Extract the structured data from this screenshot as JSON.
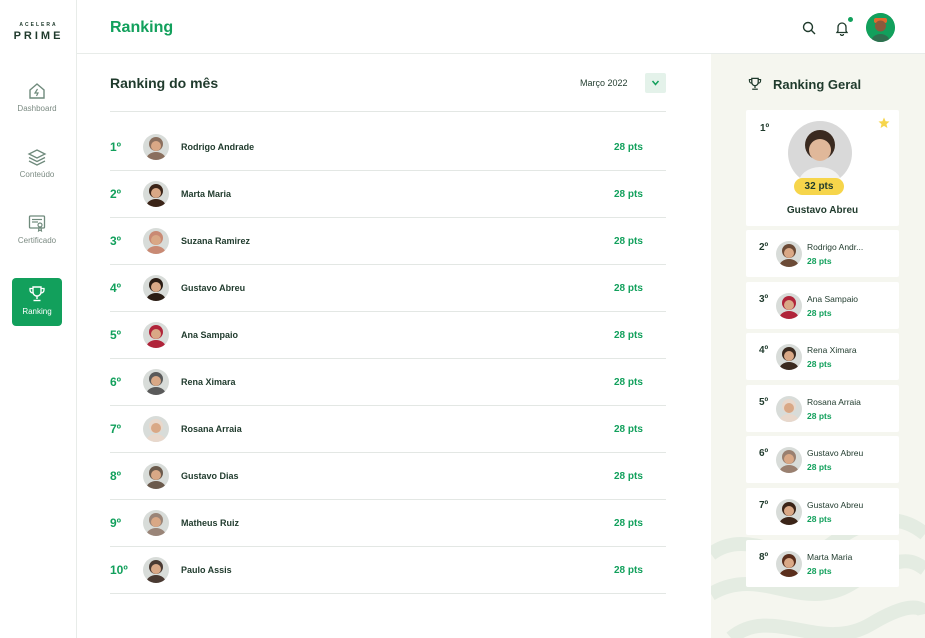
{
  "brand": {
    "top": "ACELERA",
    "bottom": "PRIME"
  },
  "sidebar": {
    "items": [
      {
        "label": "Dashboard",
        "icon": "home-icon",
        "active": false
      },
      {
        "label": "Conteúdo",
        "icon": "layers-icon",
        "active": false
      },
      {
        "label": "Certificado",
        "icon": "certificate-icon",
        "active": false
      },
      {
        "label": "Ranking",
        "icon": "trophy-icon",
        "active": true
      }
    ]
  },
  "header": {
    "title": "Ranking",
    "icons": [
      "search-icon",
      "bell-icon",
      "avatar"
    ]
  },
  "ranking_month": {
    "title": "Ranking do mês",
    "selected_month": "Março 2022",
    "rows": [
      {
        "pos": "1º",
        "name": "Rodrigo Andrade",
        "pts": "28 pts"
      },
      {
        "pos": "2º",
        "name": "Marta Maria",
        "pts": "28 pts"
      },
      {
        "pos": "3º",
        "name": "Suzana Ramirez",
        "pts": "28 pts"
      },
      {
        "pos": "4º",
        "name": "Gustavo Abreu",
        "pts": "28 pts"
      },
      {
        "pos": "5º",
        "name": "Ana Sampaio",
        "pts": "28 pts"
      },
      {
        "pos": "6º",
        "name": "Rena Ximara",
        "pts": "28 pts"
      },
      {
        "pos": "7º",
        "name": "Rosana Arraia",
        "pts": "28 pts"
      },
      {
        "pos": "8º",
        "name": "Gustavo Dias",
        "pts": "28 pts"
      },
      {
        "pos": "9º",
        "name": "Matheus Ruiz",
        "pts": "28 pts"
      },
      {
        "pos": "10º",
        "name": "Paulo Assis",
        "pts": "28 pts"
      }
    ]
  },
  "ranking_general": {
    "title": "Ranking Geral",
    "leader": {
      "pos": "1º",
      "name": "Gustavo Abreu",
      "pts": "32 pts"
    },
    "rows": [
      {
        "pos": "2º",
        "name": "Rodrigo Andr...",
        "pts": "28 pts"
      },
      {
        "pos": "3º",
        "name": "Ana Sampaio",
        "pts": "28 pts"
      },
      {
        "pos": "4º",
        "name": "Rena Ximara",
        "pts": "28 pts"
      },
      {
        "pos": "5º",
        "name": "Rosana Arraia",
        "pts": "28 pts"
      },
      {
        "pos": "6º",
        "name": "Gustavo Abreu",
        "pts": "28 pts"
      },
      {
        "pos": "7º",
        "name": "Gustavo Abreu",
        "pts": "28 pts"
      },
      {
        "pos": "8º",
        "name": "Marta Maria",
        "pts": "28 pts"
      }
    ]
  },
  "colors": {
    "accent": "#12a05c",
    "dark": "#1f3a2c",
    "badge": "#f6d54b",
    "panel_bg": "#f5f6ef"
  },
  "avatar_colors": [
    "#8a6f5e",
    "#3b2418",
    "#c98a74",
    "#2a1c14",
    "#b0243a",
    "#5a5a5a",
    "#e8d8cc",
    "#6b5a4c",
    "#9a8578",
    "#4a3a32"
  ],
  "general_avatar_colors": [
    "#6b4a36",
    "#b0243a",
    "#3a2a20",
    "#e8d8cc",
    "#9a8070",
    "#3b2418",
    "#5a2e1c"
  ]
}
